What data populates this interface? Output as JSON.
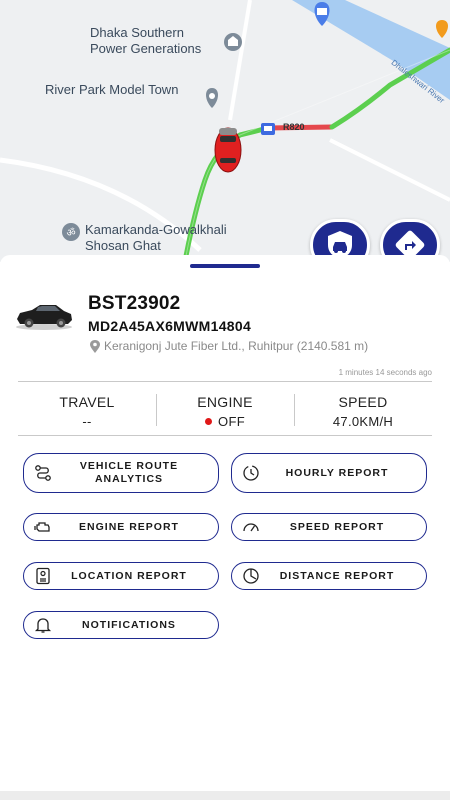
{
  "map": {
    "labels": {
      "poi_power": "Dhaka Southern\nPower Generations",
      "poi_town": "River Park Model Town",
      "poi_ghat": "Kamarkanda-Gowalkhali\nShosan Ghat",
      "river": "Dhaleshwari River",
      "route": "R820"
    },
    "colors": {
      "route_green": "#5ccf4f",
      "route_red": "#e5484d",
      "water": "#a7ccf2",
      "fab_blue": "#1f2a8f",
      "car_red": "#e02020"
    }
  },
  "vehicle": {
    "plate": "BST23902",
    "vin": "MD2A45AX6MWM14804",
    "location": "Keranigonj Jute Fiber Ltd., Ruhitpur (2140.581 m)",
    "updated": "1 minutes 14 seconds ago"
  },
  "stats": {
    "travel": {
      "title": "TRAVEL",
      "value": "--"
    },
    "engine": {
      "title": "ENGINE",
      "value": "OFF",
      "status_color": "#e01818"
    },
    "speed": {
      "title": "SPEED",
      "value": "47.0KM/H"
    }
  },
  "reports": {
    "route_analytics": {
      "label": "VEHICLE ROUTE\nANALYTICS",
      "icon": "route-icon"
    },
    "hourly": {
      "label": "HOURLY REPORT",
      "icon": "clock-icon"
    },
    "engine": {
      "label": "ENGINE REPORT",
      "icon": "engine-icon"
    },
    "speed": {
      "label": "SPEED REPORT",
      "icon": "speedometer-icon"
    },
    "location": {
      "label": "LOCATION REPORT",
      "icon": "location-document-icon"
    },
    "distance": {
      "label": "DISTANCE REPORT",
      "icon": "distance-icon"
    },
    "notifications": {
      "label": "NOTIFICATIONS",
      "icon": "bell-icon"
    }
  }
}
